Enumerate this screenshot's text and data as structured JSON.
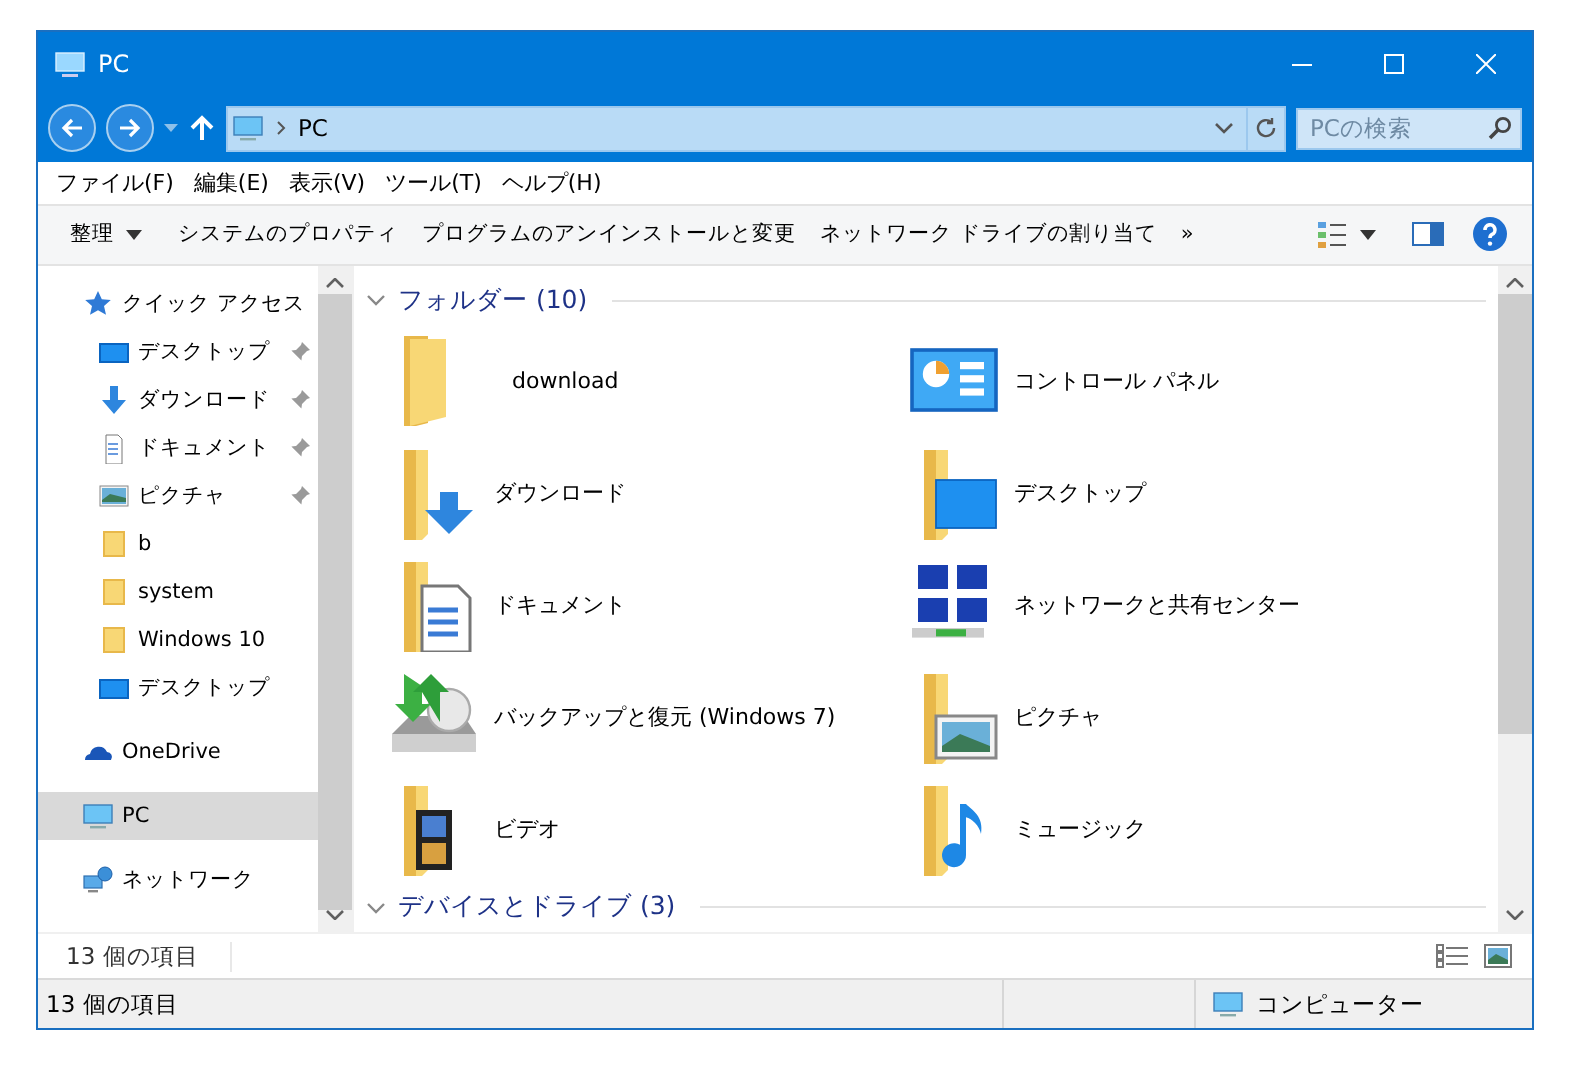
{
  "window": {
    "title": "PC"
  },
  "address": {
    "crumb": "PC"
  },
  "search": {
    "placeholder": "PCの検索"
  },
  "menu": [
    "ファイル(F)",
    "編集(E)",
    "表示(V)",
    "ツール(T)",
    "ヘルプ(H)"
  ],
  "commands": [
    {
      "label": "整理",
      "dropdown": true
    },
    {
      "label": "システムのプロパティ",
      "dropdown": false
    },
    {
      "label": "プログラムのアンインストールと変更",
      "dropdown": false
    },
    {
      "label": "ネットワーク ドライブの割り当て",
      "dropdown": false
    },
    {
      "label": "»",
      "dropdown": false
    }
  ],
  "nav": [
    {
      "label": "クイック アクセス",
      "kind": "star",
      "selected": false,
      "children": [
        {
          "label": "デスクトップ",
          "kind": "desktop",
          "pinned": true,
          "selected": false
        },
        {
          "label": "ダウンロード",
          "kind": "download",
          "pinned": true,
          "selected": false
        },
        {
          "label": "ドキュメント",
          "kind": "document",
          "pinned": true,
          "selected": false
        },
        {
          "label": "ピクチャ",
          "kind": "pictures",
          "pinned": true,
          "selected": false
        },
        {
          "label": "b",
          "kind": "folder",
          "pinned": false,
          "selected": false
        },
        {
          "label": "system",
          "kind": "folder",
          "pinned": false,
          "selected": false
        },
        {
          "label": "Windows 10",
          "kind": "folder",
          "pinned": false,
          "selected": false
        },
        {
          "label": "デスクトップ",
          "kind": "desktop",
          "pinned": false,
          "selected": false
        }
      ]
    },
    {
      "label": "OneDrive",
      "kind": "cloud",
      "selected": false
    },
    {
      "label": "PC",
      "kind": "pc",
      "selected": true
    },
    {
      "label": "ネットワーク",
      "kind": "network",
      "selected": false
    }
  ],
  "groups": [
    {
      "title": "フォルダー (10)",
      "expanded": true,
      "items": [
        {
          "label": "download",
          "kind": "folder"
        },
        {
          "label": "コントロール パネル",
          "kind": "control-panel"
        },
        {
          "label": "ダウンロード",
          "kind": "download"
        },
        {
          "label": "デスクトップ",
          "kind": "desktop"
        },
        {
          "label": "ドキュメント",
          "kind": "document"
        },
        {
          "label": "ネットワークと共有センター",
          "kind": "network-center"
        },
        {
          "label": "バックアップと復元 (Windows 7)",
          "kind": "backup"
        },
        {
          "label": "ピクチャ",
          "kind": "pictures"
        },
        {
          "label": "ビデオ",
          "kind": "video"
        },
        {
          "label": "ミュージック",
          "kind": "music"
        }
      ]
    },
    {
      "title": "デバイスとドライブ (3)",
      "expanded": true
    }
  ],
  "item_count": "13 個の項目",
  "status_bar": {
    "count": "13 個の項目",
    "location": "コンピューター"
  }
}
